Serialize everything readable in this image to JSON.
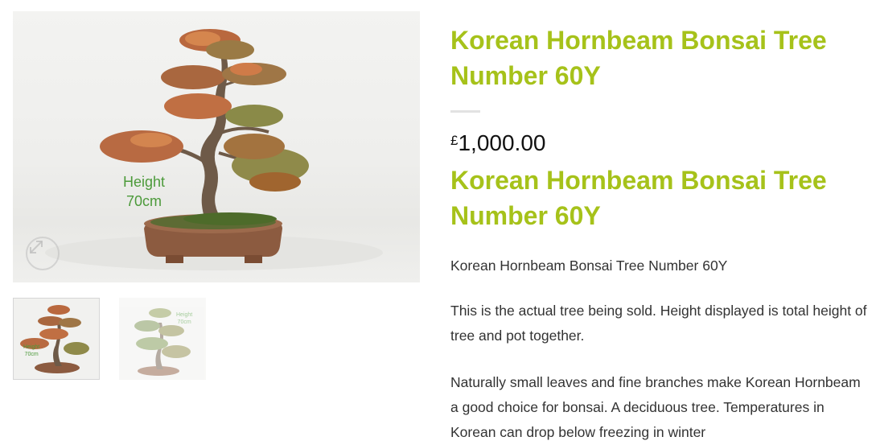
{
  "gallery": {
    "main_image_alt": "Korean Hornbeam Bonsai Tree Number 60Y",
    "height_label_line1": "Height",
    "height_label_line2": "70cm",
    "zoom_icon": "expand-arrows-icon",
    "thumbnails": [
      {
        "label_line1": "Height",
        "label_line2": "70cm",
        "active": true
      },
      {
        "label_line1": "Height",
        "label_line2": "70cm",
        "active": false
      }
    ]
  },
  "product": {
    "title": "Korean Hornbeam Bonsai Tree Number 60Y",
    "currency_symbol": "£",
    "price": "1,000.00",
    "description_heading": "Korean Hornbeam Bonsai Tree Number 60Y",
    "description": [
      "Korean Hornbeam Bonsai Tree Number 60Y",
      "This is the actual tree being sold. Height displayed is total height of tree and pot together.",
      "Naturally small leaves and fine branches make Korean Hornbeam a good choice for bonsai. A deciduous tree. Temperatures in Korean can drop below freezing in winter"
    ]
  },
  "colors": {
    "title_green": "#a6c21a",
    "label_green": "#4c9a3a",
    "price_text": "#111111",
    "body_text": "#333333"
  }
}
